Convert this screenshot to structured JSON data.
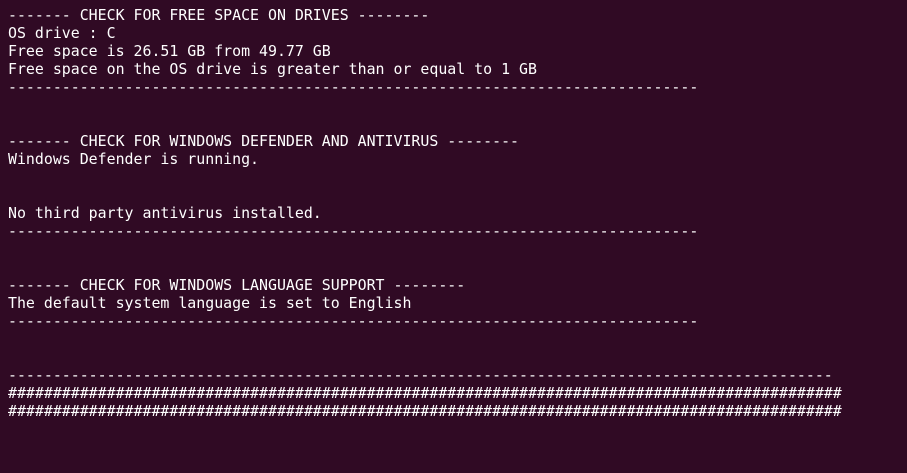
{
  "terminal": {
    "background": "#300a24",
    "foreground": "#ffffff",
    "lines": [
      "------- CHECK FOR FREE SPACE ON DRIVES --------",
      "OS drive : C",
      "Free space is 26.51 GB from 49.77 GB",
      "Free space on the OS drive is greater than or equal to 1 GB",
      "-----------------------------------------------------------------------------",
      "",
      "",
      "------- CHECK FOR WINDOWS DEFENDER AND ANTIVIRUS --------",
      "Windows Defender is running.",
      "",
      "",
      "No third party antivirus installed.",
      "-----------------------------------------------------------------------------",
      "",
      "",
      "------- CHECK FOR WINDOWS LANGUAGE SUPPORT --------",
      "The default system language is set to English",
      "-----------------------------------------------------------------------------",
      "",
      "",
      "--------------------------------------------------------------------------------------------",
      "#############################################################################################",
      "#############################################################################################",
      "",
      "",
      ""
    ]
  }
}
